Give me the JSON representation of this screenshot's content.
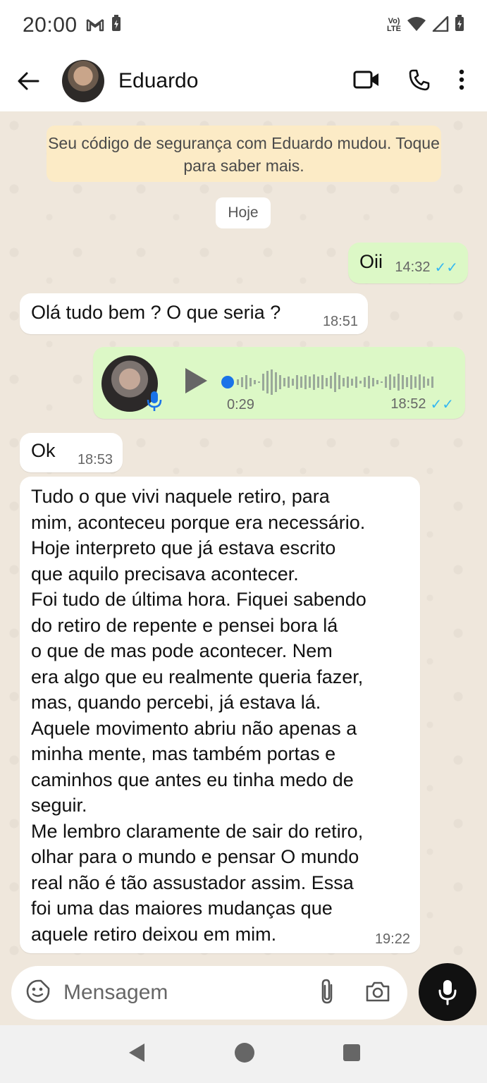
{
  "status_bar": {
    "time": "20:00",
    "network_label_top": "Vo)",
    "network_label_bottom": "LTE"
  },
  "header": {
    "contact_name": "Eduardo",
    "icons": [
      "back-arrow-icon",
      "video-call-icon",
      "phone-icon",
      "more-vertical-icon"
    ]
  },
  "chat": {
    "system_message": "Seu código de segurança com Eduardo mudou. Toque para saber mais.",
    "date_chip": "Hoje",
    "messages": [
      {
        "direction": "out",
        "text": "Oii",
        "time": "14:32",
        "read": true
      },
      {
        "direction": "in",
        "text": "Olá tudo bem ? O que seria ?",
        "time": "18:51"
      },
      {
        "direction": "out",
        "type": "voice",
        "duration": "0:29",
        "time": "18:52",
        "read": true
      },
      {
        "direction": "in",
        "text": "Ok",
        "time": "18:53"
      },
      {
        "direction": "in",
        "text": "Tudo o que vivi naquele retiro, para\nmim, aconteceu porque era necessário.\nHoje interpreto que já estava escrito\nque aquilo precisava acontecer.\nFoi tudo de última hora. Fiquei sabendo\ndo retiro de repente e pensei bora lá\no que de mas pode acontecer. Nem\nera algo que eu realmente queria fazer,\nmas, quando percebi, já estava lá.\nAquele movimento abriu não apenas a\nminha mente, mas também portas e\ncaminhos que antes eu tinha medo de\nseguir.\nMe lembro claramente de sair do retiro,\nolhar para o mundo e pensar O mundo\nreal não é tão assustador assim. Essa\nfoi uma das maiores mudanças que\naquele retiro deixou em mim.",
        "time": "19:22"
      }
    ],
    "read_ticks": "✓✓"
  },
  "input": {
    "placeholder": "Mensagem"
  },
  "colors": {
    "outgoing_bubble": "#dcf8c6",
    "incoming_bubble": "#ffffff",
    "chat_background": "#efe7dc",
    "read_tick": "#34b7f1",
    "voice_accent": "#1a73e8"
  }
}
